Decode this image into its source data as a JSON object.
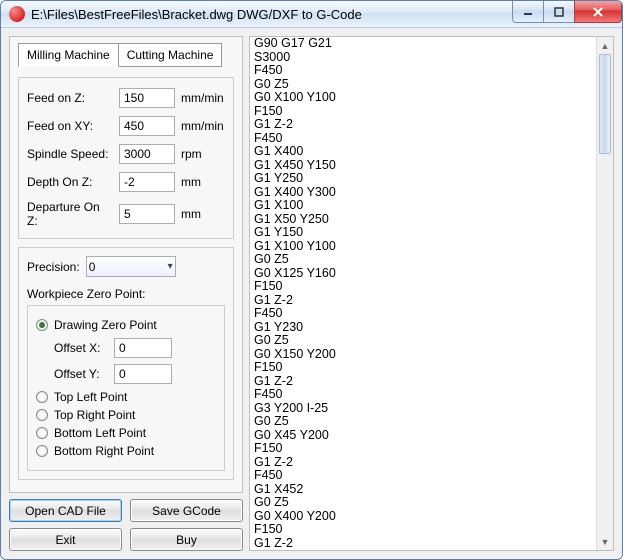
{
  "window": {
    "title": "E:\\Files\\BestFreeFiles\\Bracket.dwg DWG/DXF to G-Code"
  },
  "tabs": {
    "milling": "Milling Machine",
    "cutting": "Cutting Machine"
  },
  "fields": {
    "feedz_label": "Feed on Z:",
    "feedz_value": "150",
    "feedz_unit": "mm/min",
    "feedxy_label": "Feed on XY:",
    "feedxy_value": "450",
    "feedxy_unit": "mm/min",
    "spindle_label": "Spindle Speed:",
    "spindle_value": "3000",
    "spindle_unit": "rpm",
    "depthz_label": "Depth On Z:",
    "depthz_value": "-2",
    "depthz_unit": "mm",
    "depz_label": "Departure On Z:",
    "depz_value": "5",
    "depz_unit": "mm"
  },
  "precision": {
    "label": "Precision:",
    "value": "0"
  },
  "workpiece": {
    "title": "Workpiece Zero Point:",
    "drawing": "Drawing Zero Point",
    "offsetx_label": "Offset X:",
    "offsetx_value": "0",
    "offsety_label": "Offset Y:",
    "offsety_value": "0",
    "topleft": "Top Left Point",
    "topright": "Top Right Point",
    "bottomleft": "Bottom Left Point",
    "bottomright": "Bottom Right Point"
  },
  "buttons": {
    "open": "Open CAD File",
    "save": "Save GCode",
    "exit": "Exit",
    "buy": "Buy"
  },
  "gcode": "G90 G17 G21\nS3000\nF450\nG0 Z5\nG0 X100 Y100\nF150\nG1 Z-2\nF450\nG1 X400\nG1 X450 Y150\nG1 Y250\nG1 X400 Y300\nG1 X100\nG1 X50 Y250\nG1 Y150\nG1 X100 Y100\nG0 Z5\nG0 X125 Y160\nF150\nG1 Z-2\nF450\nG1 Y230\nG0 Z5\nG0 X150 Y200\nF150\nG1 Z-2\nF450\nG3 Y200 I-25\nG0 Z5\nG0 X45 Y200\nF150\nG1 Z-2\nF450\nG1 X452\nG0 Z5\nG0 X400 Y200\nF150\nG1 Z-2"
}
